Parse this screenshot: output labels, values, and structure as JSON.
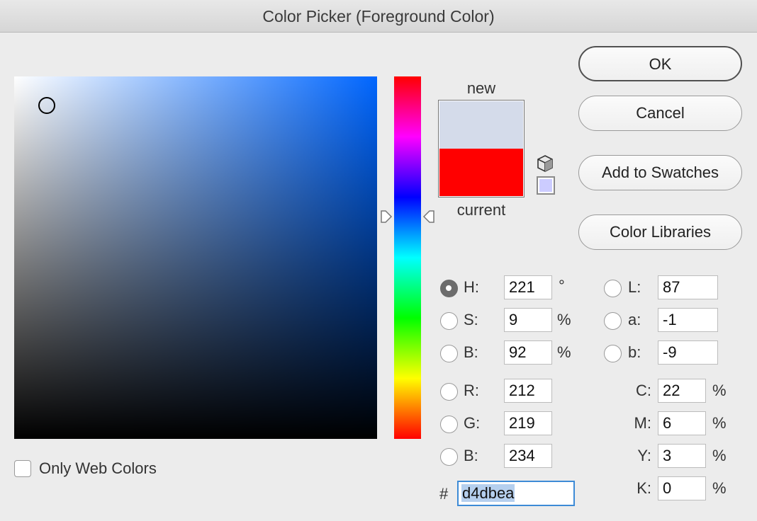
{
  "window": {
    "title": "Color Picker (Foreground Color)"
  },
  "picker": {
    "field_hue_color": "#0066ff",
    "new_label": "new",
    "current_label": "current",
    "new_color": "#d4dbea",
    "current_color": "#ff0000",
    "websafe_color": "#ccccff",
    "saturation_fraction": 0.09,
    "brightness_fraction": 0.92,
    "hue_degrees": 221
  },
  "buttons": {
    "ok": "OK",
    "cancel": "Cancel",
    "add_to_swatches": "Add to Swatches",
    "color_libraries": "Color Libraries"
  },
  "hsb": {
    "h_label": "H:",
    "h_value": "221",
    "h_unit": "°",
    "s_label": "S:",
    "s_value": "9",
    "s_unit": "%",
    "b_label": "B:",
    "b_value": "92",
    "b_unit": "%",
    "selected": "H"
  },
  "lab": {
    "l_label": "L:",
    "l_value": "87",
    "a_label": "a:",
    "a_value": "-1",
    "b_label": "b:",
    "b_value": "-9"
  },
  "rgb": {
    "r_label": "R:",
    "r_value": "212",
    "g_label": "G:",
    "g_value": "219",
    "b_label": "B:",
    "b_value": "234"
  },
  "cmyk": {
    "c_label": "C:",
    "c_value": "22",
    "c_unit": "%",
    "m_label": "M:",
    "m_value": "6",
    "m_unit": "%",
    "y_label": "Y:",
    "y_value": "3",
    "y_unit": "%",
    "k_label": "K:",
    "k_value": "0",
    "k_unit": "%"
  },
  "hex": {
    "label": "#",
    "value": "d4dbea"
  },
  "options": {
    "only_web_colors": "Only Web Colors",
    "only_web_colors_checked": false
  }
}
